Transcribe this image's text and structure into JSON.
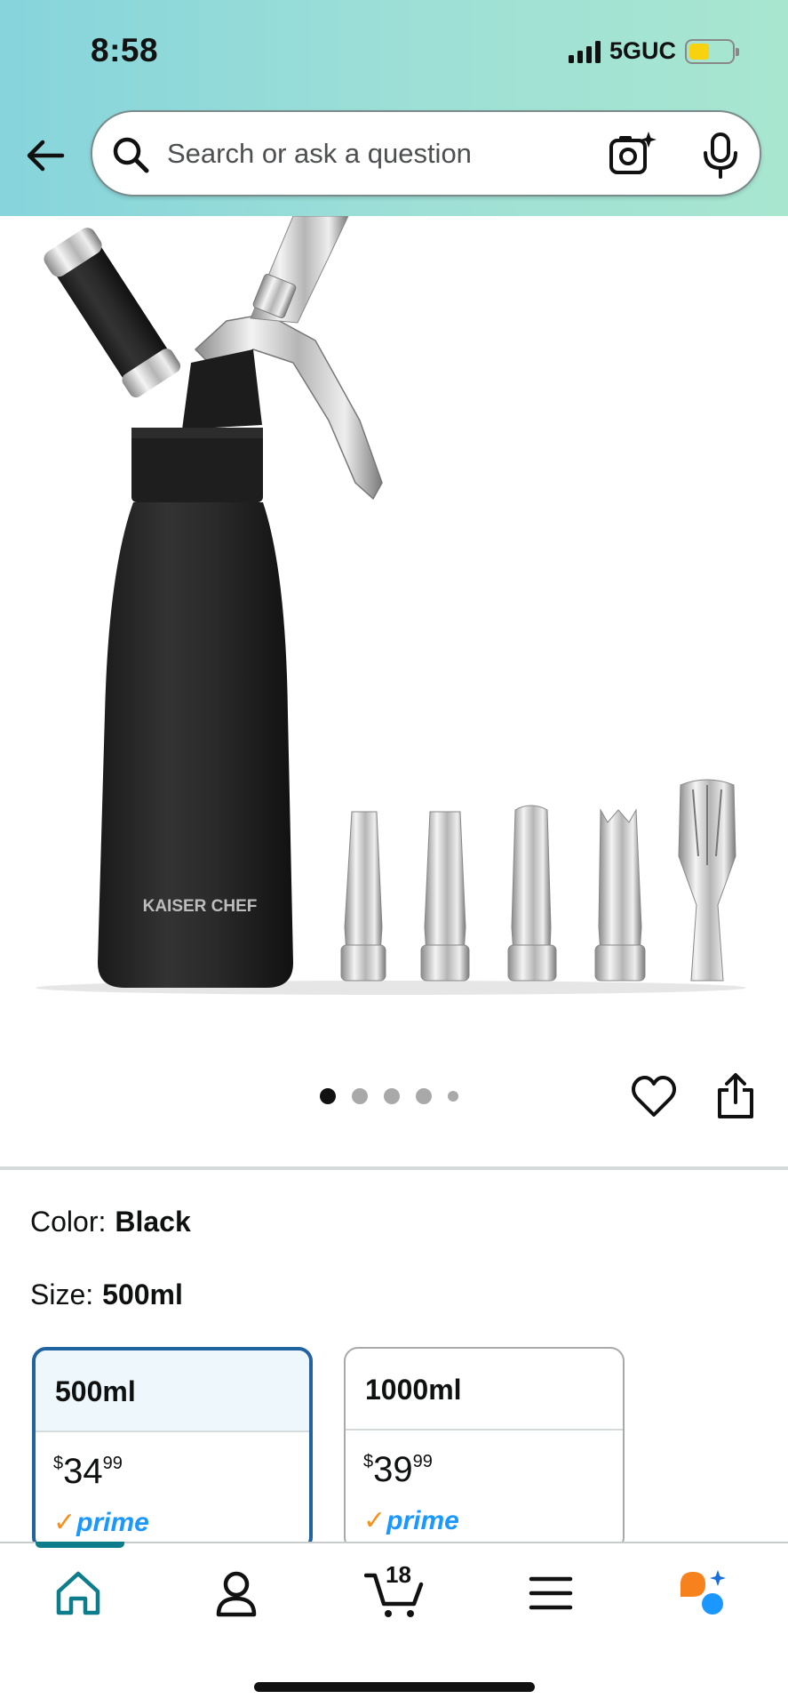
{
  "status_bar": {
    "time": "8:58",
    "network": "5GUC",
    "battery_level": 0.35
  },
  "header": {
    "back_icon": "arrow-left-icon",
    "search": {
      "placeholder": "Search or ask a question",
      "camera_icon": "camera-sparkle-icon",
      "mic_icon": "microphone-icon"
    }
  },
  "product": {
    "image_brand_text": "KAISER CHEF",
    "gallery": {
      "image_count": 5,
      "active_index": 0
    },
    "actions": {
      "wishlist_icon": "heart-icon",
      "share_icon": "share-icon"
    },
    "color": {
      "label": "Color:",
      "value": "Black"
    },
    "size": {
      "label": "Size:",
      "value": "500ml"
    },
    "size_options": [
      {
        "name": "500ml",
        "price_symbol": "$",
        "price_whole": "34",
        "price_fraction": "99",
        "badge": "prime",
        "selected": true
      },
      {
        "name": "1000ml",
        "price_symbol": "$",
        "price_whole": "39",
        "price_fraction": "99",
        "badge": "prime",
        "selected": false
      }
    ]
  },
  "bottom_nav": {
    "items": [
      {
        "name": "home",
        "icon": "home-icon",
        "active": true
      },
      {
        "name": "account",
        "icon": "person-icon",
        "active": false
      },
      {
        "name": "cart",
        "icon": "cart-icon",
        "active": false
      },
      {
        "name": "menu",
        "icon": "menu-icon",
        "active": false
      },
      {
        "name": "rufus",
        "icon": "rufus-chat-icon",
        "active": false
      }
    ],
    "cart_count": "18"
  },
  "colors": {
    "header_gradient_start": "#86d4dc",
    "header_gradient_end": "#a8e6cf",
    "selected_border": "#2162a1",
    "selected_bg": "#edf7fc",
    "prime_blue": "#1a98ff",
    "prime_check": "#f7911d",
    "active_tab": "#0d7d8b"
  }
}
